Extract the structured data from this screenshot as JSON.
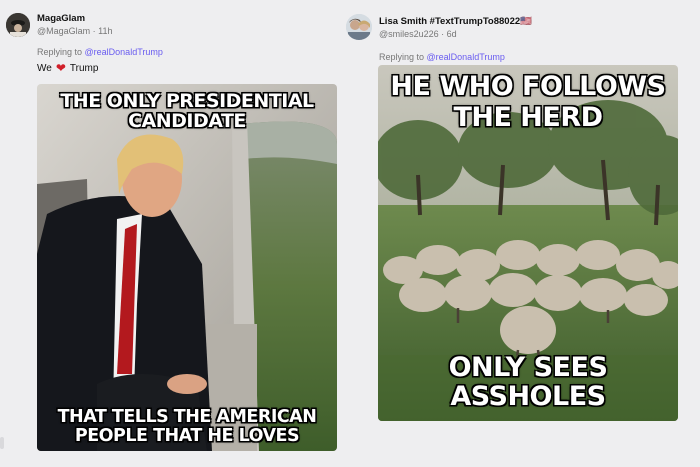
{
  "posts": [
    {
      "author": "MagaGlam",
      "handle": "@MagaGlam · 11h",
      "reply_prefix": "Replying to ",
      "reply_to": "@realDonaldTrump",
      "text_before": "We",
      "text_after": "Trump",
      "meme_top": [
        "The only presidential",
        "candidate"
      ],
      "meme_bottom": [
        "That tells the American",
        "people that he loves"
      ]
    },
    {
      "author": "Lisa Smith #TextTrumpTo88022🇺🇸",
      "handle": "@smiles2u226 · 6d",
      "reply_prefix": "Replying to ",
      "reply_to": "@realDonaldTrump",
      "meme_top": [
        "He who follows",
        "the herd"
      ],
      "meme_bottom": "Only sees assholes"
    }
  ],
  "colors": {
    "mention": "#6a5df0",
    "heart": "#d11f2a",
    "background": "#eeeef0"
  }
}
